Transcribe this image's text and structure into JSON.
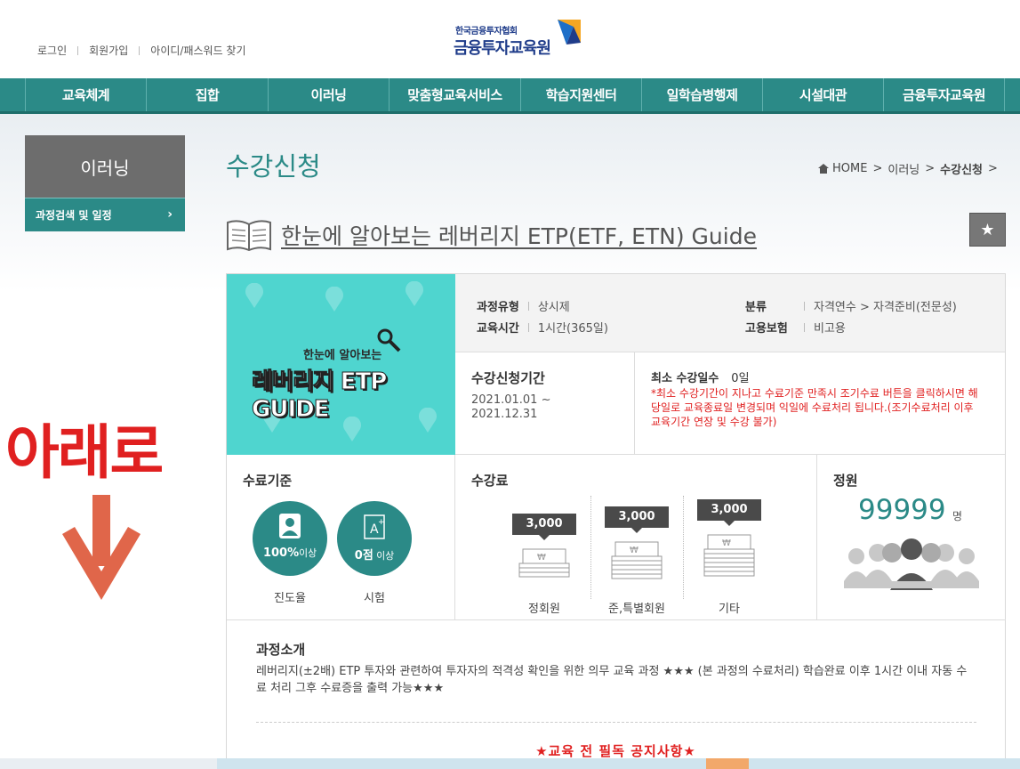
{
  "top_links": [
    "로그인",
    "회원가입",
    "아이디/패스워드 찾기"
  ],
  "logo": {
    "sub": "한국금융투자협회",
    "main": "금융투자교육원"
  },
  "nav": [
    "교육체계",
    "집합",
    "이러닝",
    "맞춤형교육서비스",
    "학습지원센터",
    "일학습병행제",
    "시설대관",
    "금융투자교육원"
  ],
  "sidebar": {
    "title": "이러닝",
    "item": "과정검색 및 일정",
    "chevron": "›"
  },
  "annotation": {
    "text": "아래로"
  },
  "page": {
    "title": "수강신청"
  },
  "breadcrumb": {
    "home": "HOME",
    "level1": "이러닝",
    "current": "수강신청"
  },
  "course": {
    "title": "한눈에 알아보는 레버리지 ETP(ETF, ETN) Guide",
    "thumb_sub": "한눈에 알아보는",
    "thumb_main": "레버리지 ETP GUIDE"
  },
  "meta": {
    "type_label": "과정유형",
    "type_value": "상시제",
    "time_label": "교육시간",
    "time_value": "1시간(365일)",
    "cat_label": "분류",
    "cat_value": "자격연수 > 자격준비(전문성)",
    "ins_label": "고용보험",
    "ins_value": "비고용"
  },
  "period": {
    "label": "수강신청기간",
    "value": "2021.01.01 ~ 2021.12.31"
  },
  "min_days": {
    "label": "최소 수강일수",
    "value": "0일",
    "note": "*최소 수강기간이 지나고 수료기준 만족시 조기수료 버튼을 클릭하시면 해당일로 교육종료일 변경되며 익일에 수료처리 됩니다.(조기수료처리 이후 교육기간 연장 및 수강 불가)"
  },
  "completion": {
    "heading": "수료기준",
    "progress_value": "100%",
    "progress_suffix": "이상",
    "progress_label": "진도율",
    "exam_value": "0점",
    "exam_suffix": " 이상",
    "exam_label": "시험"
  },
  "fee": {
    "heading": "수강료",
    "items": [
      {
        "price": "3,000",
        "label": "정회원"
      },
      {
        "price": "3,000",
        "label": "준,특별회원"
      },
      {
        "price": "3,000",
        "label": "기타"
      }
    ]
  },
  "capacity": {
    "heading": "정원",
    "value": "99999",
    "unit": "명"
  },
  "intro": {
    "heading": "과정소개",
    "text": "레버리지(±2배) ETP 투자와 관련하여 투자자의 적격성 확인을 위한 의무 교육 과정 ★★★ (본 과정의 수료처리) 학습완료 이후 1시간 이내 자동 수료 처리 그후 수료증을 출력 가능★★★",
    "notice": "★교육 전 필독 공지사항★"
  },
  "colors": {
    "teal": "#2b8a87",
    "red": "#e02020",
    "gray": "#6d6d6d"
  }
}
